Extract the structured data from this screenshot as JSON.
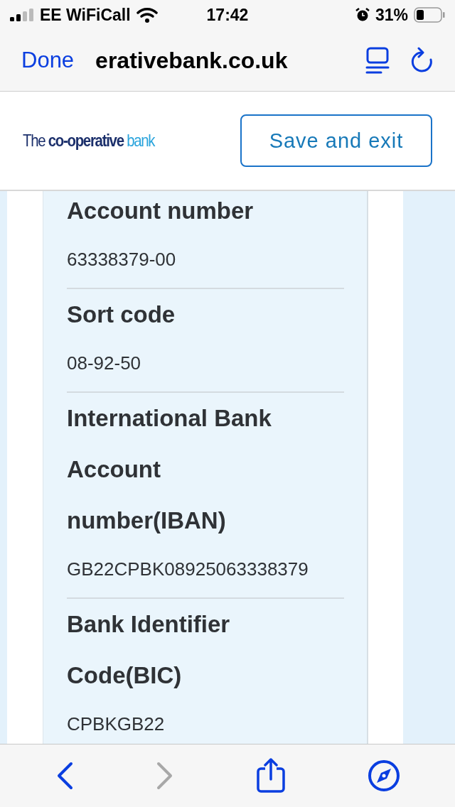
{
  "status_bar": {
    "carrier": "EE WiFiCall",
    "time": "17:42",
    "battery": "31%"
  },
  "browser_bar": {
    "done": "Done",
    "url": "erativebank.co.uk"
  },
  "header": {
    "logo": {
      "prefix": "The",
      "name": "co-operative",
      "suffix": "bank"
    },
    "save_button": "Save and exit"
  },
  "details": [
    {
      "label": "Account number",
      "value": "63338379-00"
    },
    {
      "label": "Sort code",
      "value": "08-92-50"
    },
    {
      "label": "International Bank Account number(IBAN)",
      "value": "GB22CPBK08925063338379"
    },
    {
      "label": "Bank Identifier Code(BIC)",
      "value": "CPBKGB22"
    }
  ],
  "toolbar": [
    {
      "kind": "back",
      "disabled": false
    },
    {
      "kind": "forward",
      "disabled": true
    },
    {
      "kind": "share",
      "disabled": false
    },
    {
      "kind": "compass",
      "disabled": false
    }
  ]
}
